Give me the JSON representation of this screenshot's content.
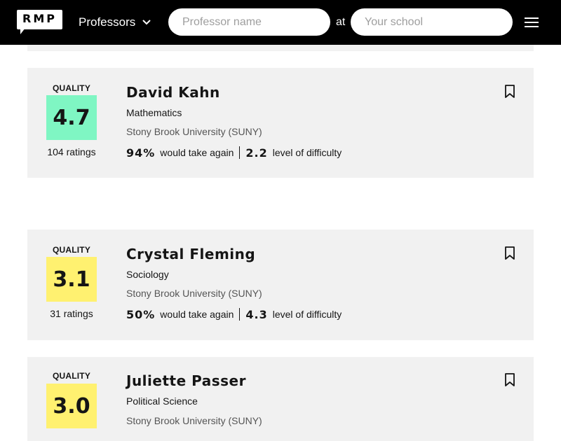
{
  "header": {
    "logo_text": "RMP",
    "nav_select_label": "Professors",
    "professor_search_placeholder": "Professor name",
    "at_label": "at",
    "school_search_placeholder": "Your school"
  },
  "colors": {
    "header_bg": "#000000",
    "card_bg": "#f1f1f1",
    "quality_high": "#7ff6c3",
    "quality_mid": "#fff170"
  },
  "cards": [
    {
      "quality_label": "QUALITY",
      "quality": "4.7",
      "quality_color": "#7ff6c3",
      "ratings": "104 ratings",
      "name": "David Kahn",
      "department": "Mathematics",
      "school": "Stony Brook University (SUNY)",
      "would_take_again": "94%",
      "would_take_again_label": "would take again",
      "difficulty": "2.2",
      "difficulty_label": "level of difficulty"
    },
    {
      "quality_label": "QUALITY",
      "quality": "3.1",
      "quality_color": "#fff170",
      "ratings": "31 ratings",
      "name": "Crystal Fleming",
      "department": "Sociology",
      "school": "Stony Brook University (SUNY)",
      "would_take_again": "50%",
      "would_take_again_label": "would take again",
      "difficulty": "4.3",
      "difficulty_label": "level of difficulty"
    },
    {
      "quality_label": "QUALITY",
      "quality": "3.0",
      "quality_color": "#fff170",
      "name": "Juliette Passer",
      "department": "Political Science",
      "school": "Stony Brook University (SUNY)"
    }
  ]
}
